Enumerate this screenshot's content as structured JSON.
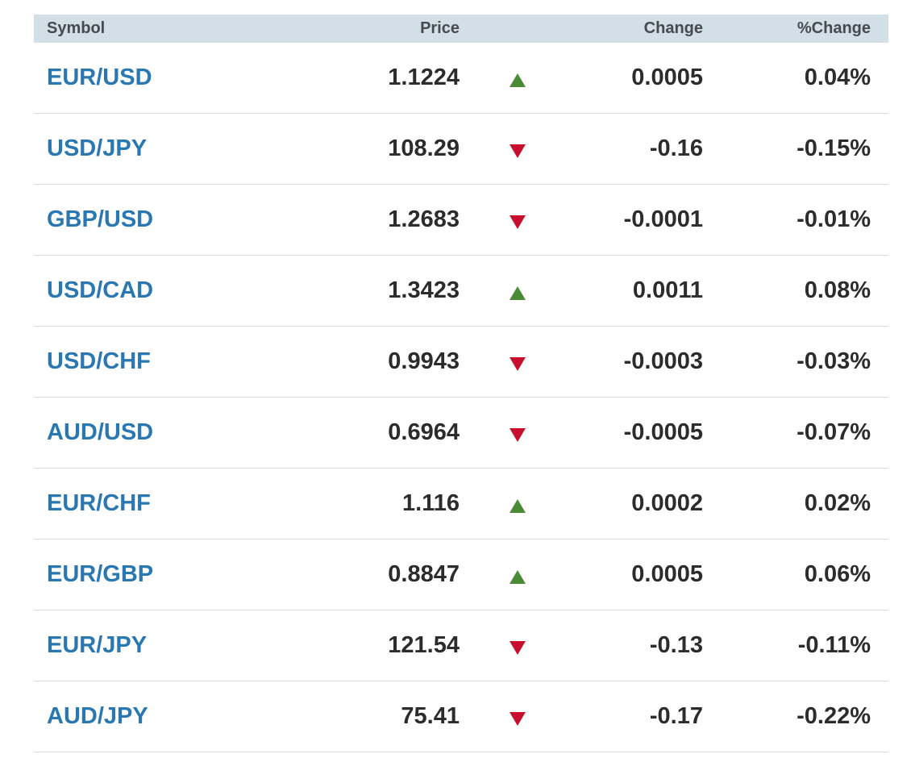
{
  "header": {
    "symbol": "Symbol",
    "price": "Price",
    "change": "Change",
    "pct_change": "%Change"
  },
  "colors": {
    "header_bg": "#d2dfe6",
    "symbol_link": "#2a78b2",
    "up": "#4a8c35",
    "down": "#c8102e"
  },
  "rows": [
    {
      "symbol": "EUR/USD",
      "price": "1.1224",
      "direction": "up",
      "direction_icon": "triangle-up-icon",
      "change": "0.0005",
      "pct_change": "0.04%"
    },
    {
      "symbol": "USD/JPY",
      "price": "108.29",
      "direction": "down",
      "direction_icon": "triangle-down-icon",
      "change": "-0.16",
      "pct_change": "-0.15%"
    },
    {
      "symbol": "GBP/USD",
      "price": "1.2683",
      "direction": "down",
      "direction_icon": "triangle-down-icon",
      "change": "-0.0001",
      "pct_change": "-0.01%"
    },
    {
      "symbol": "USD/CAD",
      "price": "1.3423",
      "direction": "up",
      "direction_icon": "triangle-up-icon",
      "change": "0.0011",
      "pct_change": "0.08%"
    },
    {
      "symbol": "USD/CHF",
      "price": "0.9943",
      "direction": "down",
      "direction_icon": "triangle-down-icon",
      "change": "-0.0003",
      "pct_change": "-0.03%"
    },
    {
      "symbol": "AUD/USD",
      "price": "0.6964",
      "direction": "down",
      "direction_icon": "triangle-down-icon",
      "change": "-0.0005",
      "pct_change": "-0.07%"
    },
    {
      "symbol": "EUR/CHF",
      "price": "1.116",
      "direction": "up",
      "direction_icon": "triangle-up-icon",
      "change": "0.0002",
      "pct_change": "0.02%"
    },
    {
      "symbol": "EUR/GBP",
      "price": "0.8847",
      "direction": "up",
      "direction_icon": "triangle-up-icon",
      "change": "0.0005",
      "pct_change": "0.06%"
    },
    {
      "symbol": "EUR/JPY",
      "price": "121.54",
      "direction": "down",
      "direction_icon": "triangle-down-icon",
      "change": "-0.13",
      "pct_change": "-0.11%"
    },
    {
      "symbol": "AUD/JPY",
      "price": "75.41",
      "direction": "down",
      "direction_icon": "triangle-down-icon",
      "change": "-0.17",
      "pct_change": "-0.22%"
    }
  ]
}
